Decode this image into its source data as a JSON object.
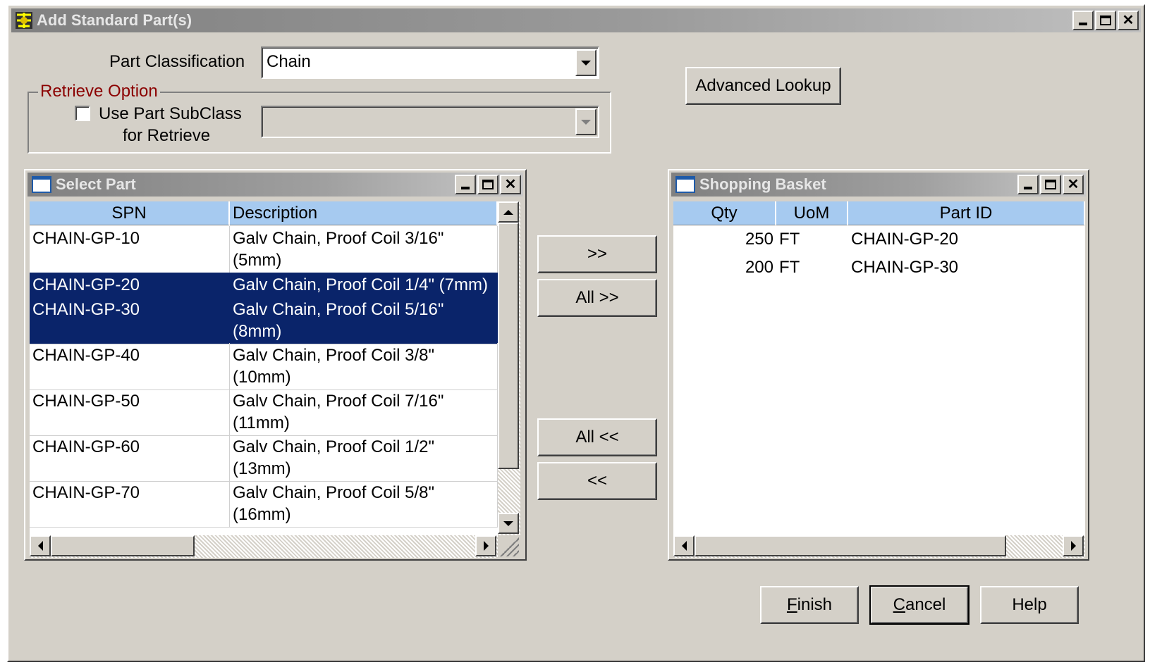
{
  "window": {
    "title": "Add Standard Part(s)"
  },
  "form": {
    "part_classification_label": "Part Classification",
    "part_classification_value": "Chain",
    "retrieve_option_label": "Retrieve Option",
    "use_subclass_line1": "Use Part SubClass",
    "use_subclass_line2": "for Retrieve",
    "use_subclass_checked": false,
    "subclass_value": "",
    "advanced_lookup_label": "Advanced Lookup"
  },
  "select_part": {
    "title": "Select Part",
    "columns": [
      "SPN",
      "Description"
    ],
    "rows": [
      {
        "spn": "CHAIN-GP-10",
        "desc1": "Galv Chain, Proof Coil 3/16\"",
        "desc2": "(5mm)",
        "selected": false
      },
      {
        "spn": "CHAIN-GP-20",
        "desc1": "Galv Chain, Proof Coil 1/4\" (7mm)",
        "desc2": "",
        "selected": true
      },
      {
        "spn": "CHAIN-GP-30",
        "desc1": "Galv Chain, Proof Coil 5/16\"",
        "desc2": "(8mm)",
        "selected": true
      },
      {
        "spn": "CHAIN-GP-40",
        "desc1": "Galv Chain, Proof Coil 3/8\"",
        "desc2": "(10mm)",
        "selected": false
      },
      {
        "spn": "CHAIN-GP-50",
        "desc1": "Galv Chain, Proof Coil 7/16\"",
        "desc2": "(11mm)",
        "selected": false
      },
      {
        "spn": "CHAIN-GP-60",
        "desc1": "Galv Chain, Proof Coil 1/2\"",
        "desc2": "(13mm)",
        "selected": false
      },
      {
        "spn": "CHAIN-GP-70",
        "desc1": "Galv Chain, Proof Coil 5/8\"",
        "desc2": "(16mm)",
        "selected": false
      }
    ]
  },
  "transfer": {
    "add_label": ">>",
    "add_all_label": "All >>",
    "remove_all_label": "All <<",
    "remove_label": "<<"
  },
  "basket": {
    "title": "Shopping Basket",
    "columns": [
      "Qty",
      "UoM",
      "Part ID"
    ],
    "rows": [
      {
        "qty": "250",
        "uom": "FT",
        "part_id": "CHAIN-GP-20"
      },
      {
        "qty": "200",
        "uom": "FT",
        "part_id": "CHAIN-GP-30"
      }
    ]
  },
  "footer": {
    "finish_mnemonic": "F",
    "finish_rest": "inish",
    "cancel_mnemonic": "C",
    "cancel_rest": "ancel",
    "help_label": "Help"
  },
  "colors": {
    "face": "#d4d0c8",
    "header": "#a6caf0",
    "selection": "#0a246a",
    "legend": "#8b0000"
  },
  "icons": {
    "app": "app-icon",
    "minimize": "minimize-icon",
    "maximize": "maximize-icon",
    "close": "close-icon"
  }
}
